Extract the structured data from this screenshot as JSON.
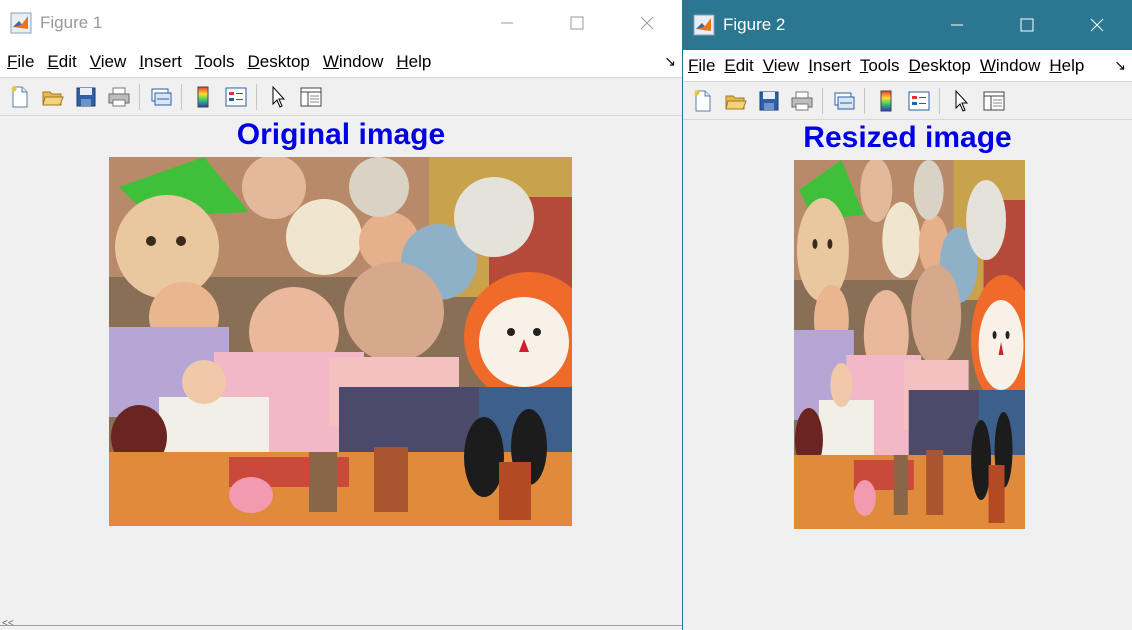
{
  "figure1": {
    "title": "Figure 1",
    "menu": [
      {
        "u": "F",
        "rest": "ile"
      },
      {
        "u": "E",
        "rest": "dit"
      },
      {
        "u": "V",
        "rest": "iew"
      },
      {
        "u": "I",
        "rest": "nsert"
      },
      {
        "u": "T",
        "rest": "ools"
      },
      {
        "u": "D",
        "rest": "esktop"
      },
      {
        "u": "W",
        "rest": "indow"
      },
      {
        "u": "H",
        "rest": "elp"
      }
    ],
    "axes_title": "Original image"
  },
  "figure2": {
    "title": "Figure 2",
    "menu": [
      {
        "u": "F",
        "rest": "ile"
      },
      {
        "u": "E",
        "rest": "dit"
      },
      {
        "u": "V",
        "rest": "iew"
      },
      {
        "u": "I",
        "rest": "nsert"
      },
      {
        "u": "T",
        "rest": "ools"
      },
      {
        "u": "D",
        "rest": "esktop"
      },
      {
        "u": "W",
        "rest": "indow"
      },
      {
        "u": "H",
        "rest": "elp"
      }
    ],
    "axes_title": "Resized image"
  },
  "toolbar_icons": [
    "new-figure-icon",
    "open-file-icon",
    "save-icon",
    "print-icon",
    "link-plot-icon",
    "colorbar-icon",
    "legend-icon",
    "pointer-icon",
    "property-inspector-icon"
  ],
  "colors": {
    "titlebar_active": "#2b7792",
    "axes_title": "#0000e6",
    "background": "#f0f0f0"
  },
  "dock_glyph": "↘",
  "bottom_glyph": "<<"
}
